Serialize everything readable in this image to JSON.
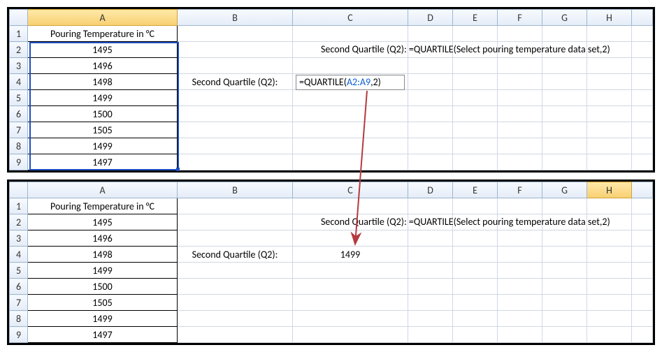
{
  "columns": [
    "A",
    "B",
    "C",
    "D",
    "E",
    "F",
    "G",
    "H"
  ],
  "rows": [
    "1",
    "2",
    "3",
    "4",
    "5",
    "6",
    "7",
    "8",
    "9"
  ],
  "headerA": "Pouring Temperature in °C",
  "data_values": [
    "1495",
    "1496",
    "1498",
    "1499",
    "1500",
    "1505",
    "1499",
    "1497"
  ],
  "label_b4": "Second Quartile (Q2):",
  "top": {
    "explain": "Second Quartile (Q2): =QUARTILE(Select pouring temperature data set,2)",
    "formula_prefix": "=QUARTILE(",
    "formula_ref": "A2:A9",
    "formula_suffix": ",2)"
  },
  "bottom": {
    "explain": "Second Quartile (Q2): =QUARTILE(Select pouring temperature data set,2)",
    "result_c4": "1499"
  }
}
